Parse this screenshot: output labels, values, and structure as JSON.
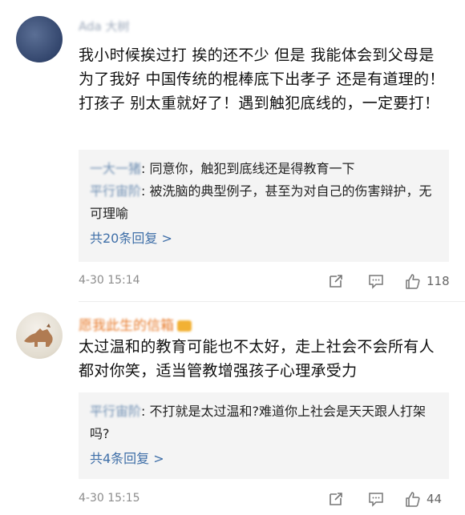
{
  "comments": [
    {
      "username": "Ada 大树",
      "text": "我小时候挨过打 挨的还不少  但是 我能体会到父母是为了我好 中国传统的棍棒底下出孝子 还是有道理的！打孩子 别太重就好了！遇到触犯底线的，一定要打！",
      "replies": [
        {
          "user": "一大一猪",
          "text": ": 同意你，触犯到底线还是得教育一下"
        },
        {
          "user": "平行宙阶",
          "text": ": 被洗脑的典型例子，甚至为对自己的伤害辩护，无可理喻"
        }
      ],
      "view_more": "共20条回复 >",
      "time": "4-30 15:14",
      "likes": "118"
    },
    {
      "username": "愿我此生的信箱",
      "text": "太过温和的教育可能也不太好，走上社会不会所有人都对你笑，适当管教增强孩子心理承受力",
      "replies": [
        {
          "user": "平行宙阶",
          "text": ": 不打就是太过温和?难道你上社会是天天跟人打架吗?"
        }
      ],
      "view_more": "共4条回复 >",
      "time": "4-30 15:15",
      "likes": "44"
    }
  ],
  "icons": {
    "share": "share-icon",
    "comment": "comment-icon",
    "like": "like-icon"
  },
  "colors": {
    "link": "#3f6fa8",
    "meta": "#8c8c8c",
    "reply_bg": "#f4f4f4",
    "username_orange": "#e77a2a"
  }
}
